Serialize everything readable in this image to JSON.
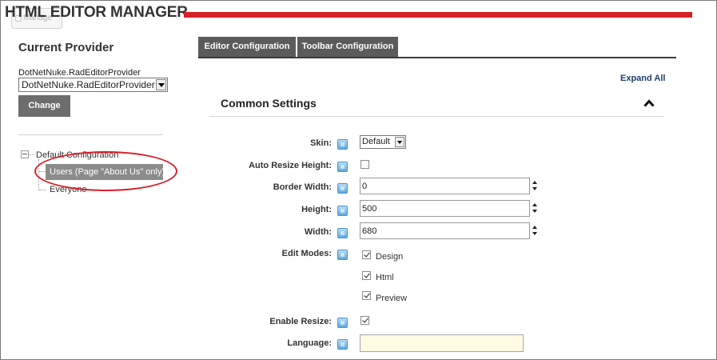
{
  "header": {
    "title": "HTML EDITOR MANAGER",
    "manage_label": "Manage",
    "accent_color": "#d71f27"
  },
  "left_panel": {
    "heading": "Current Provider",
    "provider_label": "DotNetNuke.RadEditorProvider",
    "provider_select_value": "DotNetNuke.RadEditorProvider",
    "change_button": "Change",
    "tree": {
      "root": "Default Configuration",
      "children": [
        "Users (Page \"About Us\" only)",
        "Everyone"
      ],
      "selected_index": 0
    }
  },
  "tabs": [
    "Editor Configuration",
    "Toolbar Configuration"
  ],
  "expand_all": "Expand All",
  "section": {
    "title": "Common Settings",
    "collapse_icon": "chevron-up-icon"
  },
  "settings": {
    "skin": {
      "label": "Skin:",
      "value": "Default"
    },
    "auto_resize": {
      "label": "Auto Resize Height:",
      "checked": false
    },
    "border_width": {
      "label": "Border Width:",
      "value": "0"
    },
    "height": {
      "label": "Height:",
      "value": "500"
    },
    "width": {
      "label": "Width:",
      "value": "680"
    },
    "edit_modes": {
      "label": "Edit Modes:",
      "options": [
        {
          "label": "Design",
          "checked": true
        },
        {
          "label": "Html",
          "checked": true
        },
        {
          "label": "Preview",
          "checked": true
        }
      ]
    },
    "enable_resize": {
      "label": "Enable Resize:",
      "checked": true
    },
    "language": {
      "label": "Language:",
      "value": ""
    }
  },
  "icons": {
    "help": "help-icon",
    "spin": "spinner-arrows-icon",
    "tree_toggle": "tree-collapse-icon"
  }
}
